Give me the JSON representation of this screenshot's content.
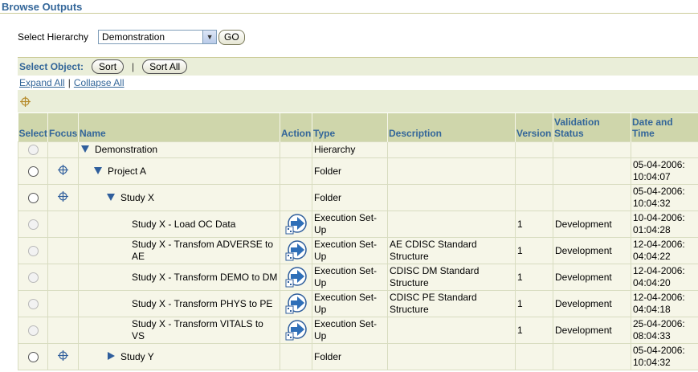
{
  "page_title": "Browse Outputs",
  "hierarchy": {
    "label": "Select Hierarchy",
    "selected": "Demonstration",
    "go_label": "GO"
  },
  "toolbar": {
    "label": "Select Object:",
    "sort_label": "Sort",
    "sort_all_label": "Sort All"
  },
  "links": {
    "expand_all": "Expand All",
    "collapse_all": "Collapse All"
  },
  "columns": {
    "select": "Select",
    "focus": "Focus",
    "name": "Name",
    "action": "Action",
    "type": "Type",
    "description": "Description",
    "version": "Version",
    "validation_status": "Validation Status",
    "date_time": "Date and Time"
  },
  "rows": [
    {
      "name": "Demonstration",
      "type": "Hierarchy",
      "description": "",
      "version": "",
      "status": "",
      "datetime": ""
    },
    {
      "name": "Project A",
      "type": "Folder",
      "description": "",
      "version": "",
      "status": "",
      "datetime": "05-04-2006: 10:04:07"
    },
    {
      "name": "Study X",
      "type": "Folder",
      "description": "",
      "version": "",
      "status": "",
      "datetime": "05-04-2006: 10:04:32"
    },
    {
      "name": "Study X - Load OC Data",
      "type": "Execution Set-Up",
      "description": "",
      "version": "1",
      "status": "Development",
      "datetime": "10-04-2006: 01:04:28"
    },
    {
      "name": "Study X - Transfom ADVERSE to AE",
      "type": "Execution Set-Up",
      "description": "AE CDISC Standard Structure",
      "version": "1",
      "status": "Development",
      "datetime": "12-04-2006: 04:04:22"
    },
    {
      "name": "Study X - Transform DEMO to DM",
      "type": "Execution Set-Up",
      "description": "CDISC DM Standard Structure",
      "version": "1",
      "status": "Development",
      "datetime": "12-04-2006: 04:04:20"
    },
    {
      "name": "Study X - Transform PHYS to PE",
      "type": "Execution Set-Up",
      "description": "CDISC PE Standard Structure",
      "version": "1",
      "status": "Development",
      "datetime": "12-04-2006: 04:04:18"
    },
    {
      "name": "Study X - Transform VITALS to VS",
      "type": "Execution Set-Up",
      "description": "",
      "version": "1",
      "status": "Development",
      "datetime": "25-04-2006: 08:04:33"
    },
    {
      "name": "Study Y",
      "type": "Folder",
      "description": "",
      "version": "",
      "status": "",
      "datetime": "05-04-2006: 10:04:32"
    }
  ],
  "colors": {
    "header_bg": "#cfd6ab",
    "label_blue": "#336699",
    "row_bg": "#f6f6e8"
  }
}
